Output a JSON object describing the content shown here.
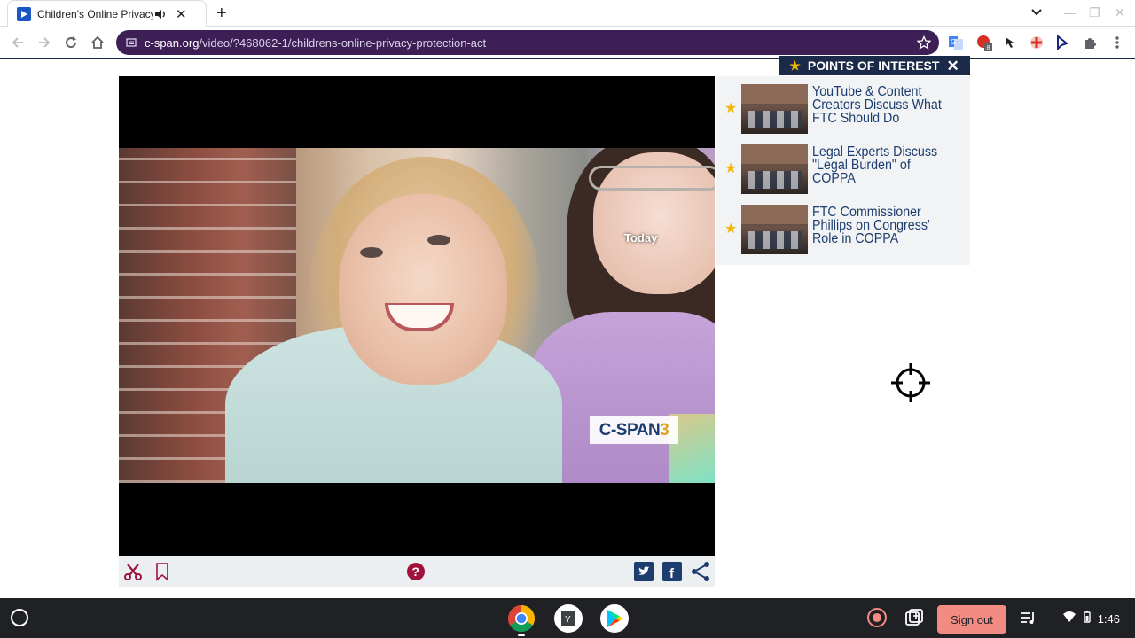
{
  "browser": {
    "tab_title": "Children's Online Privacy Protection Act",
    "url_host": "c-span.org",
    "url_path": "/video/?468062-1/childrens-online-privacy-protection-act",
    "omnibox_color": "#3d1f56",
    "extension_badge": "8"
  },
  "video": {
    "today_badge": "Today",
    "logo_text": "C-SPAN",
    "logo_suffix": "3",
    "logo_colors": {
      "primary": "#1d3d6e",
      "accent": "#e0a21f"
    }
  },
  "player_controls": {
    "icons": [
      "scissors-icon",
      "bookmark-icon",
      "help-icon",
      "twitter-icon",
      "facebook-icon",
      "share-icon"
    ],
    "accent": "#a0123c"
  },
  "points_of_interest": {
    "title": "POINTS OF INTEREST",
    "close_label": "✕",
    "items": [
      {
        "title": "YouTube & Content Creators Discuss What FTC Should Do"
      },
      {
        "title": "Legal Experts Discuss \"Legal Burden\" of COPPA"
      },
      {
        "title": "FTC Commissioner Phillips on Congress' Role in COPPA"
      }
    ],
    "star_color": "#f2b705"
  },
  "shelf": {
    "apps": [
      "chrome-icon",
      "youtube-app-icon",
      "play-store-icon"
    ],
    "signout_label": "Sign out",
    "time": "1:46"
  }
}
